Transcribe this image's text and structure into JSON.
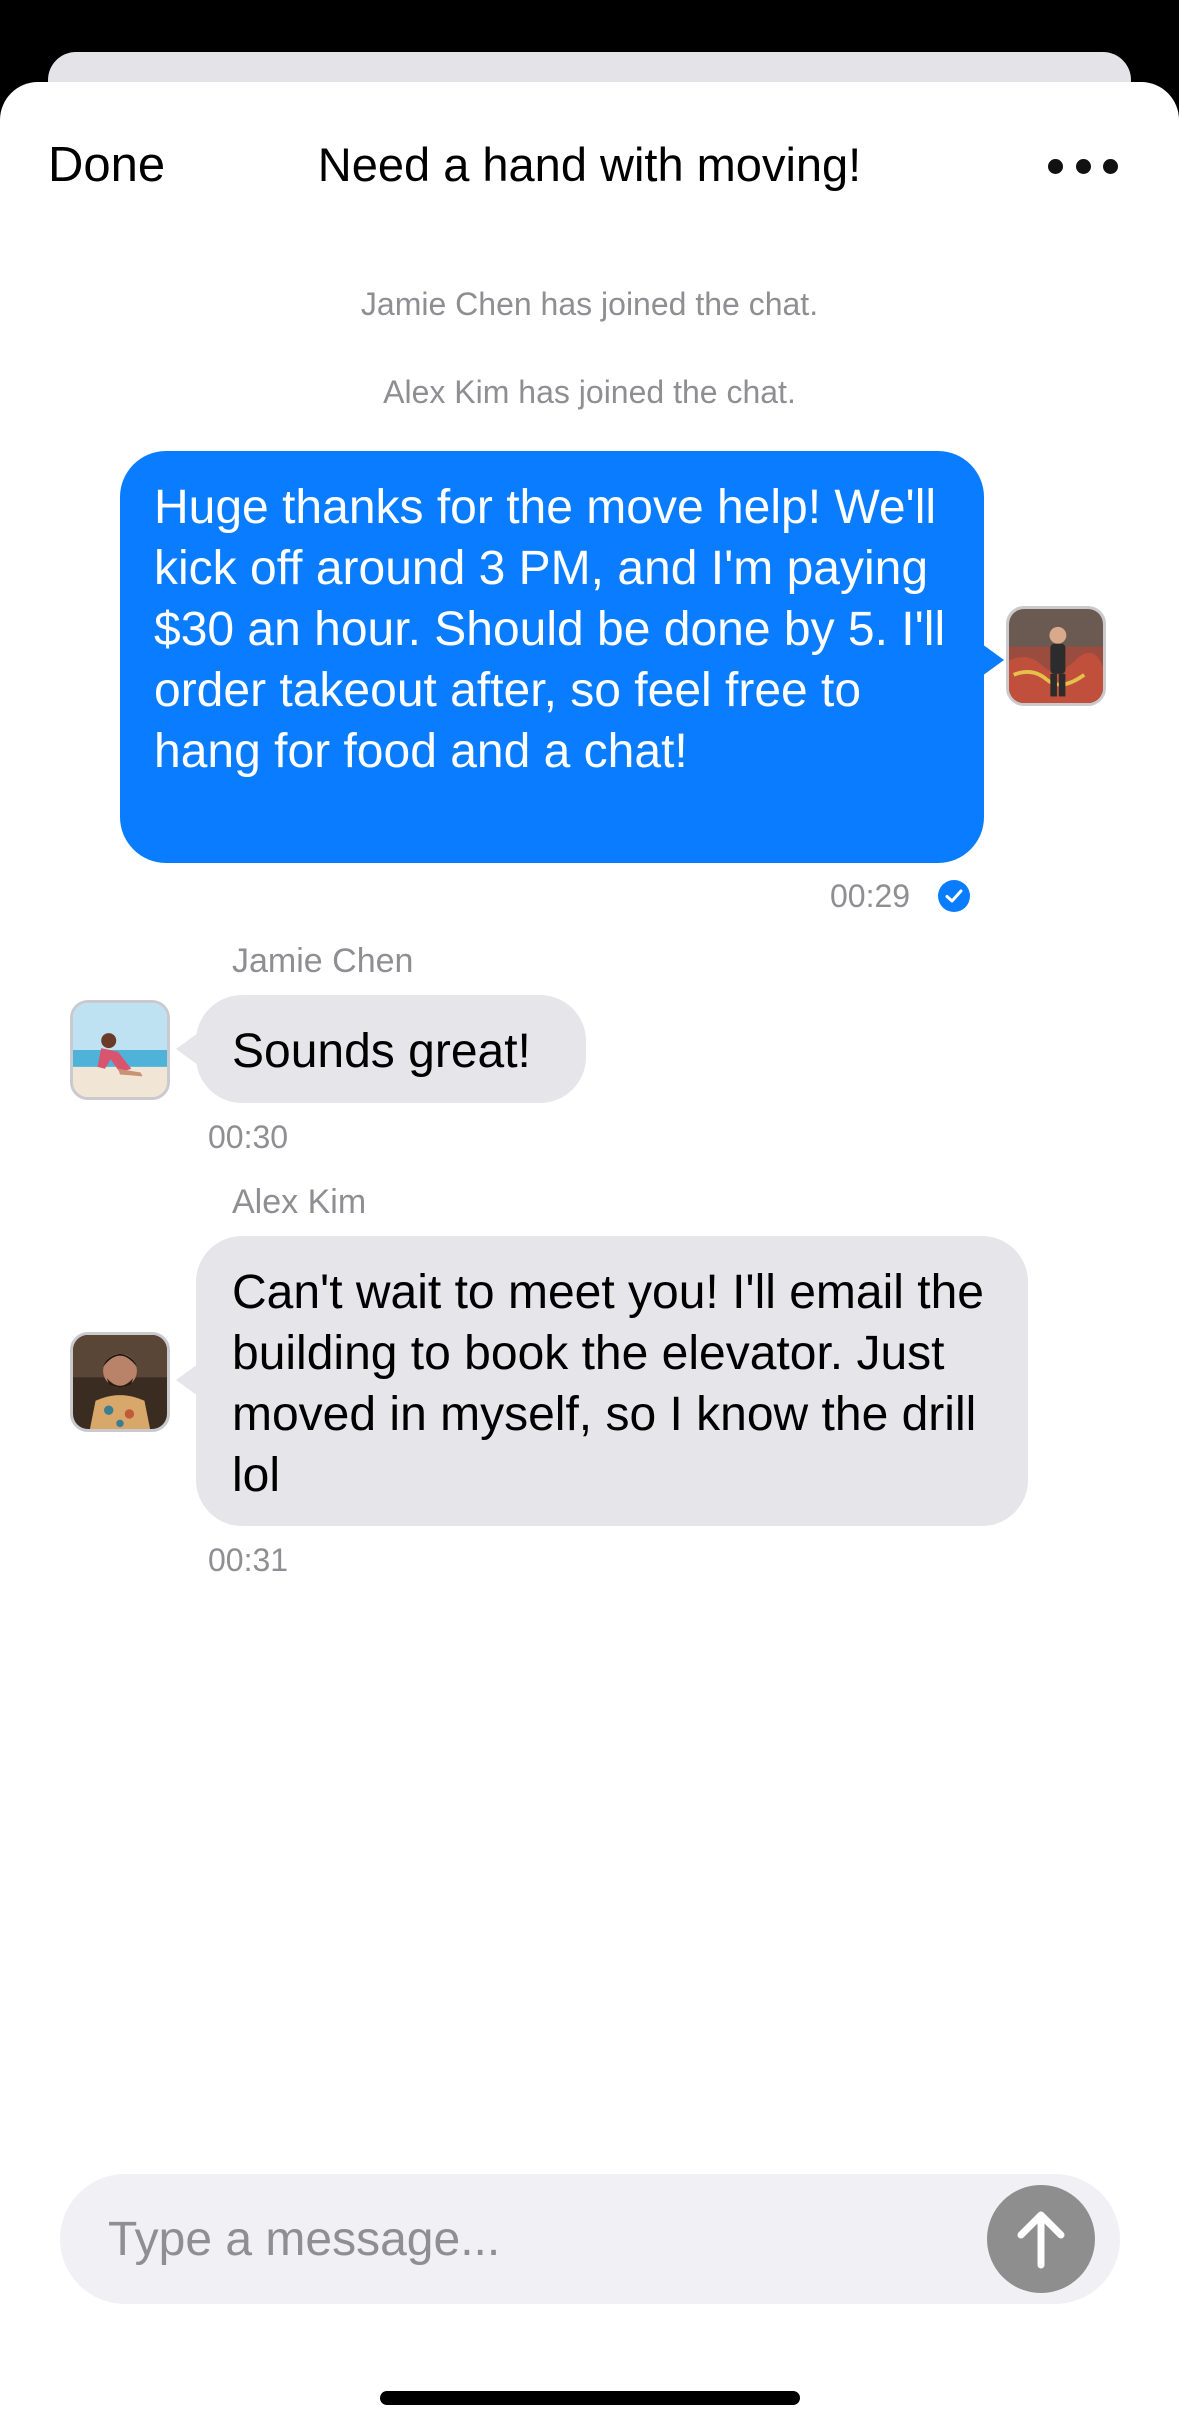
{
  "header": {
    "done_label": "Done",
    "title": "Need a hand with moving!"
  },
  "system_messages": [
    "Jamie Chen has joined the chat.",
    "Alex Kim has joined the chat."
  ],
  "messages": [
    {
      "direction": "outgoing",
      "text": "Huge thanks for the move help! We'll kick off around 3 PM, and I'm paying $30 an hour. Should be done by 5. I'll order takeout after, so feel free to hang for food and a chat!",
      "time": "00:29",
      "status": "read"
    },
    {
      "direction": "incoming",
      "sender": "Jamie Chen",
      "text": "Sounds great!",
      "time": "00:30"
    },
    {
      "direction": "incoming",
      "sender": "Alex Kim",
      "text": "Can't wait to meet you! I'll email the building to book the elevator. Just moved in myself, so I know the drill lol",
      "time": "00:31"
    }
  ],
  "composer": {
    "placeholder": "Type a message..."
  },
  "colors": {
    "outgoing_bubble": "#0a7cff",
    "incoming_bubble": "#e5e5ea",
    "send_button": "#8e8e8e"
  },
  "icons": {
    "more": "more-horizontal-icon",
    "read_status": "check-circle-icon",
    "send": "arrow-up-icon"
  }
}
